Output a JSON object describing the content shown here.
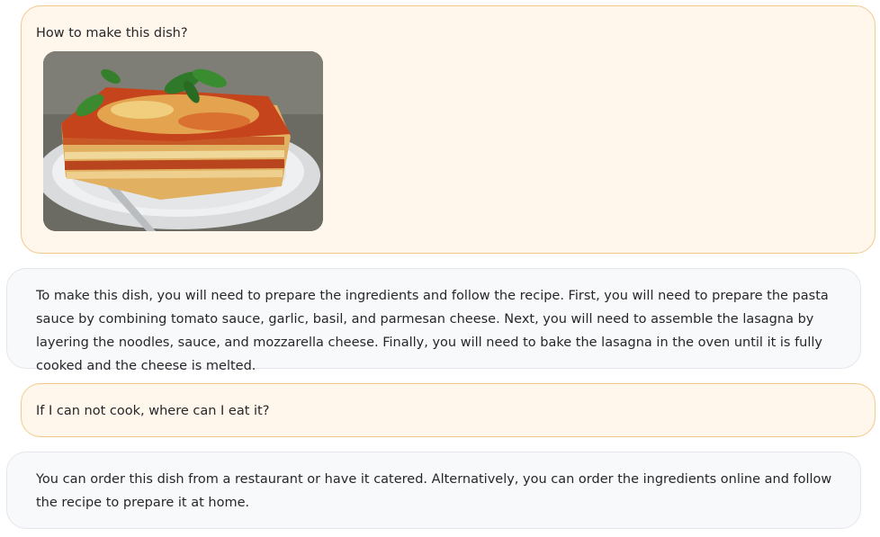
{
  "conversation": {
    "messages": [
      {
        "role": "user",
        "text": "How to make this dish?",
        "image": "lasagna-photo"
      },
      {
        "role": "assistant",
        "text": "To make this dish, you will need to prepare the ingredients and follow the recipe. First, you will need to prepare the pasta sauce by combining tomato sauce, garlic, basil, and parmesan cheese. Next, you will need to assemble the lasagna by layering the noodles, sauce, and mozzarella cheese. Finally, you will need to bake the lasagna in the oven until it is fully cooked and the cheese is melted."
      },
      {
        "role": "user",
        "text": "If I can not cook, where can I eat it?"
      },
      {
        "role": "assistant",
        "text": "You can order this dish from a restaurant or have it catered. Alternatively, you can order the ingredients online and follow the recipe to prepare it at home."
      }
    ]
  },
  "colors": {
    "user_bubble_bg": "#fff6ec",
    "user_bubble_border": "#f3c98b",
    "assistant_bubble_bg": "#f8f9fb",
    "assistant_bubble_border": "#e4e6eb",
    "text": "#27272a"
  }
}
